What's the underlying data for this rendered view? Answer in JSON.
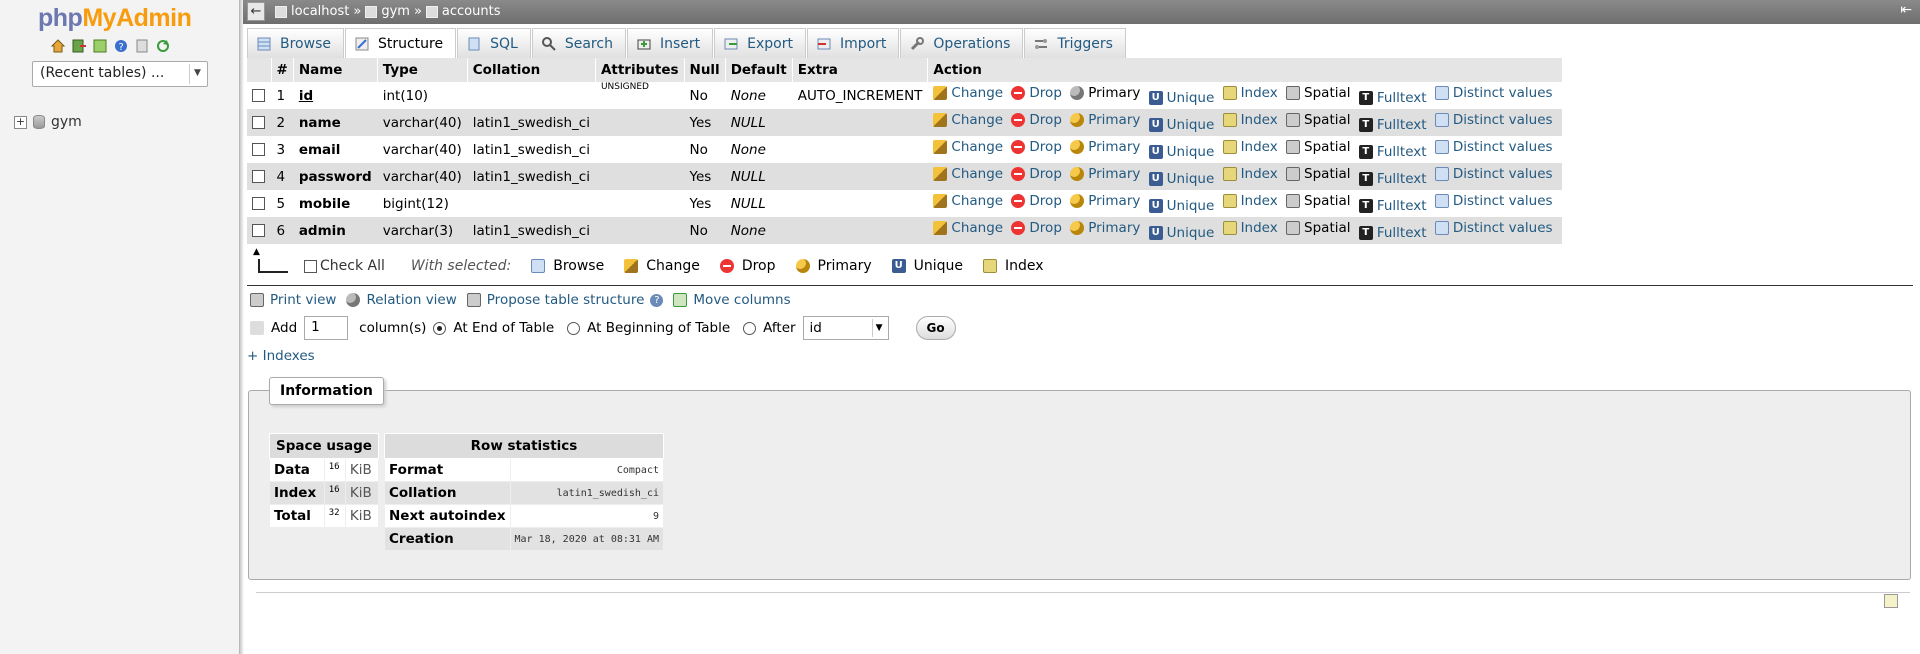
{
  "nav": {
    "logo_php": "php",
    "logo_my": "My",
    "logo_admin": "Admin",
    "recent_tables": "(Recent tables) ...",
    "db_item": "gym",
    "icons": [
      "home-icon",
      "exit-icon",
      "sql-query-icon",
      "docs-icon",
      "settings-icon",
      "reload-icon"
    ]
  },
  "topbar": {
    "server": "localhost",
    "sep1": "»",
    "database": "gym",
    "sep2": "»",
    "table": "accounts"
  },
  "tabs": [
    {
      "label": "Browse",
      "icon": "browse-icon"
    },
    {
      "label": "Structure",
      "icon": "structure-icon"
    },
    {
      "label": "SQL",
      "icon": "sql-icon"
    },
    {
      "label": "Search",
      "icon": "search-icon"
    },
    {
      "label": "Insert",
      "icon": "insert-icon"
    },
    {
      "label": "Export",
      "icon": "export-icon"
    },
    {
      "label": "Import",
      "icon": "import-icon"
    },
    {
      "label": "Operations",
      "icon": "operations-icon"
    },
    {
      "label": "Triggers",
      "icon": "triggers-icon"
    }
  ],
  "structure": {
    "headers": {
      "num": "#",
      "name": "Name",
      "type": "Type",
      "collation": "Collation",
      "attributes": "Attributes",
      "null": "Null",
      "default": "Default",
      "extra": "Extra",
      "action": "Action"
    },
    "actions": {
      "change": "Change",
      "drop": "Drop",
      "primary": "Primary",
      "unique": "Unique",
      "index": "Index",
      "spatial": "Spatial",
      "fulltext": "Fulltext",
      "distinct": "Distinct values"
    },
    "rows": [
      {
        "num": "1",
        "name": "id",
        "type": "int(10)",
        "collation": "",
        "attributes": "UNSIGNED",
        "null": "No",
        "default": "None",
        "extra": "AUTO_INCREMENT"
      },
      {
        "num": "2",
        "name": "name",
        "type": "varchar(40)",
        "collation": "latin1_swedish_ci",
        "attributes": "",
        "null": "Yes",
        "default": "NULL",
        "extra": ""
      },
      {
        "num": "3",
        "name": "email",
        "type": "varchar(40)",
        "collation": "latin1_swedish_ci",
        "attributes": "",
        "null": "No",
        "default": "None",
        "extra": ""
      },
      {
        "num": "4",
        "name": "password",
        "type": "varchar(40)",
        "collation": "latin1_swedish_ci",
        "attributes": "",
        "null": "Yes",
        "default": "NULL",
        "extra": ""
      },
      {
        "num": "5",
        "name": "mobile",
        "type": "bigint(12)",
        "collation": "",
        "attributes": "",
        "null": "Yes",
        "default": "NULL",
        "extra": ""
      },
      {
        "num": "6",
        "name": "admin",
        "type": "varchar(3)",
        "collation": "latin1_swedish_ci",
        "attributes": "",
        "null": "No",
        "default": "None",
        "extra": ""
      }
    ]
  },
  "with_selected": {
    "check_all": "Check All",
    "label": "With selected:",
    "browse": "Browse",
    "change": "Change",
    "drop": "Drop",
    "primary": "Primary",
    "unique": "Unique",
    "index": "Index"
  },
  "links": {
    "print_view": "Print view",
    "relation_view": "Relation view",
    "propose": "Propose table structure",
    "move_columns": "Move columns"
  },
  "add_column": {
    "add": "Add",
    "count": "1",
    "columns": "column(s)",
    "at_end": "At End of Table",
    "at_beginning": "At Beginning of Table",
    "after": "After",
    "after_value": "id",
    "go": "Go"
  },
  "indexes_link": "+ Indexes",
  "information": {
    "legend": "Information",
    "space": {
      "title": "Space usage",
      "rows": [
        {
          "label": "Data",
          "value": "16",
          "unit": "KiB"
        },
        {
          "label": "Index",
          "value": "16",
          "unit": "KiB"
        },
        {
          "label": "Total",
          "value": "32",
          "unit": "KiB"
        }
      ]
    },
    "rowstats": {
      "title": "Row statistics",
      "rows": [
        {
          "label": "Format",
          "value": "Compact"
        },
        {
          "label": "Collation",
          "value": "latin1_swedish_ci"
        },
        {
          "label": "Next autoindex",
          "value": "9"
        },
        {
          "label": "Creation",
          "value": "Mar 18, 2020 at 08:31 AM"
        }
      ]
    }
  }
}
